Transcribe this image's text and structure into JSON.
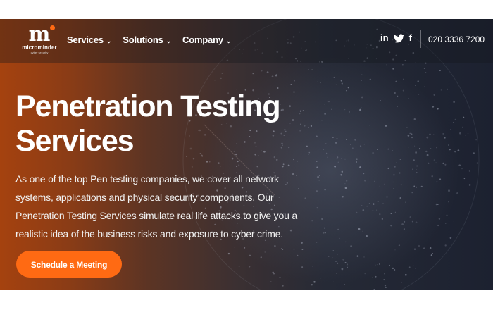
{
  "brand": {
    "logo_mark": "m",
    "name": "microminder",
    "tagline": "cyber security",
    "accent_color": "#ff6a13"
  },
  "nav": {
    "items": [
      {
        "label": "Services",
        "icon": "chevron-down-icon"
      },
      {
        "label": "Solutions",
        "icon": "chevron-down-icon"
      },
      {
        "label": "Company",
        "icon": "chevron-down-icon"
      }
    ]
  },
  "social": {
    "linkedin": "in",
    "twitter_icon": "twitter-bird-icon",
    "facebook": "f"
  },
  "contact": {
    "phone": "020 3336 7200"
  },
  "hero": {
    "title_line1": "Penetration Testing",
    "title_line2": "Services",
    "description": "As one of the top Pen testing companies, we cover all network systems, applications and physical security components. Our Penetration Testing Services simulate real life attacks to give you a realistic idea of the business risks and exposure to cyber crime.",
    "cta_label": "Schedule a Meeting",
    "background_icon": "globe-network-icon"
  }
}
